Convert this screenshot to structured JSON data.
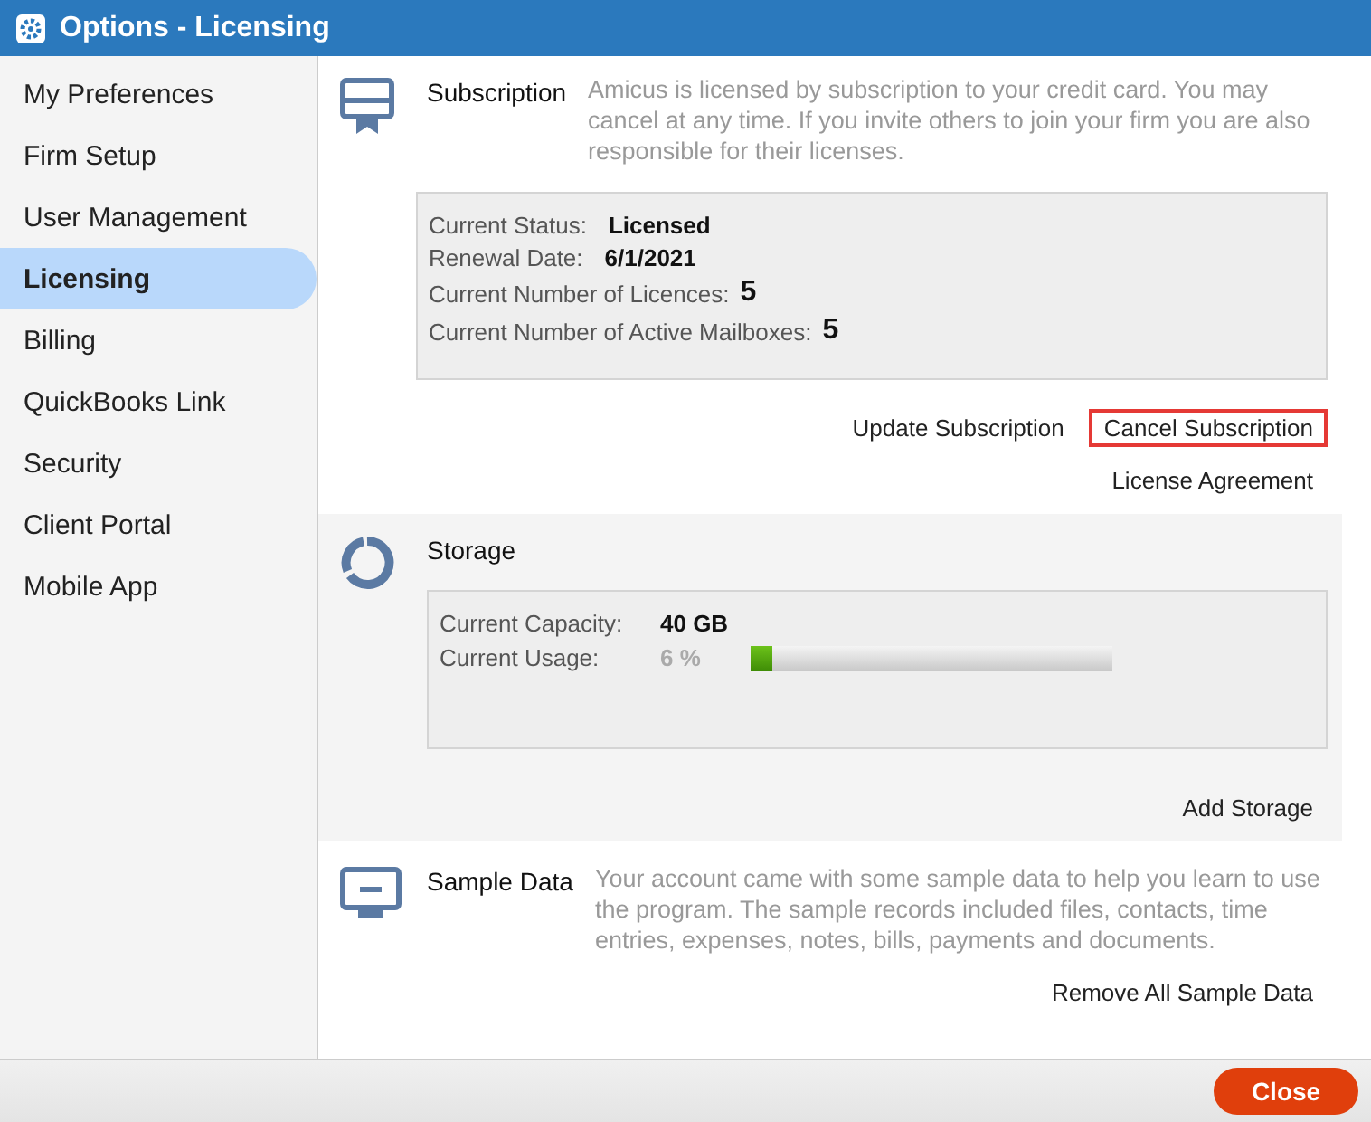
{
  "window": {
    "title": "Options - Licensing"
  },
  "sidebar": {
    "items": [
      {
        "label": "My Preferences",
        "selected": false
      },
      {
        "label": "Firm Setup",
        "selected": false
      },
      {
        "label": "User Management",
        "selected": false
      },
      {
        "label": "Licensing",
        "selected": true
      },
      {
        "label": "Billing",
        "selected": false
      },
      {
        "label": "QuickBooks Link",
        "selected": false
      },
      {
        "label": "Security",
        "selected": false
      },
      {
        "label": "Client Portal",
        "selected": false
      },
      {
        "label": "Mobile App",
        "selected": false
      }
    ]
  },
  "sections": [
    {
      "kind": "subscription",
      "title": "Subscription",
      "description": "Amicus is licensed by subscription to your credit card. You may cancel at any time. If you invite others to join your firm you are also responsible for their licenses.",
      "fields": [
        {
          "kind": "text",
          "label": "Current Status:",
          "value": "Licensed"
        },
        {
          "kind": "text",
          "label": "Renewal Date:",
          "value": "6/1/2021"
        },
        {
          "kind": "count",
          "label": "Current Number of Licences:",
          "value": "5"
        },
        {
          "kind": "count",
          "label": "Current Number of Active Mailboxes:",
          "value": "5"
        }
      ],
      "actions": [
        [
          {
            "label": "Update Subscription",
            "highlighted": false
          },
          {
            "label": "Cancel Subscription",
            "highlighted": true
          }
        ],
        [
          {
            "label": "License Agreement",
            "highlighted": false
          }
        ]
      ]
    },
    {
      "kind": "storage",
      "title": "Storage",
      "fields": [
        {
          "kind": "text",
          "label": "Current Capacity:",
          "value": "40 GB"
        },
        {
          "kind": "meter",
          "label": "Current Usage:",
          "value": "6 %",
          "level": 0.06
        }
      ],
      "actions": [
        [
          {
            "label": "Add Storage",
            "highlighted": false
          }
        ]
      ]
    },
    {
      "kind": "sample",
      "title": "Sample Data",
      "description": "Your account came with some sample data to help you learn to use the program. The sample records included files, contacts, time entries, expenses, notes, bills, payments and documents.",
      "actions": [
        [
          {
            "label": "Remove All Sample Data",
            "highlighted": false
          }
        ]
      ]
    }
  ],
  "footer": {
    "close_button": "Close"
  }
}
